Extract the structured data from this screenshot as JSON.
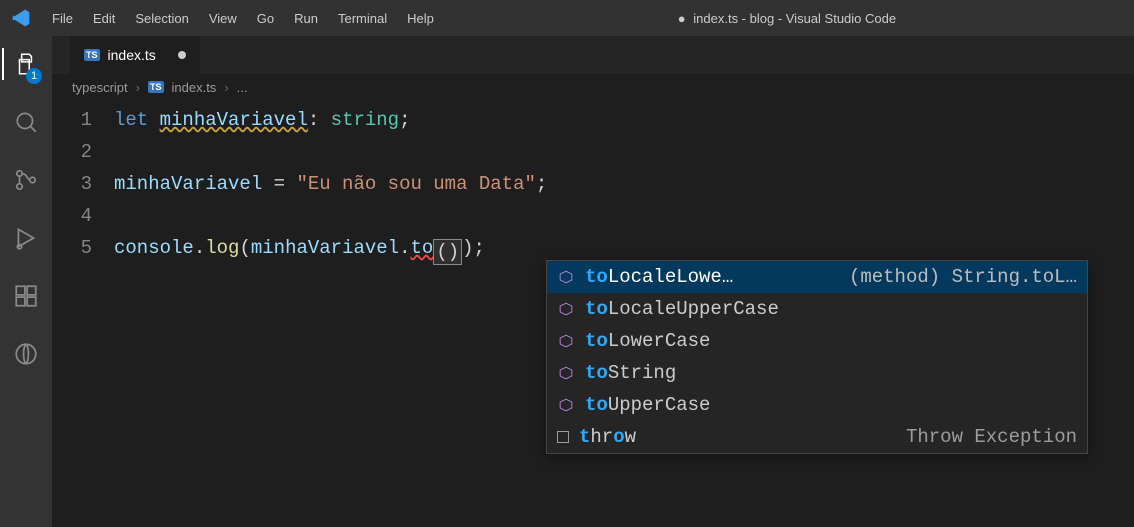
{
  "window": {
    "title_prefix": "●",
    "title": "index.ts - blog - Visual Studio Code"
  },
  "menu": {
    "items": [
      "File",
      "Edit",
      "Selection",
      "View",
      "Go",
      "Run",
      "Terminal",
      "Help"
    ]
  },
  "activity": {
    "explorer_badge": "1"
  },
  "tab": {
    "icon_text": "TS",
    "label": "index.ts"
  },
  "breadcrumbs": {
    "items": [
      "typescript",
      "index.ts",
      "..."
    ],
    "icon_text": "TS"
  },
  "editor": {
    "gutter": [
      "1",
      "2",
      "3",
      "4",
      "5"
    ],
    "line1": {
      "kw": "let",
      "sp1": " ",
      "var": "minhaVariavel",
      "colon": ":",
      "sp2": " ",
      "type": "string",
      "semi": ";"
    },
    "line3": {
      "var": "minhaVariavel",
      "sp1": " ",
      "eq": "=",
      "sp2": " ",
      "str": "\"Eu não sou uma Data\"",
      "semi": ";"
    },
    "line5": {
      "obj": "console",
      "dot1": ".",
      "method": "log",
      "lpar": "(",
      "arg": "minhaVariavel",
      "dot2": ".",
      "partial": "to",
      "inner": "()",
      "rpar": ")",
      "semi": ";"
    }
  },
  "suggest": {
    "items": [
      {
        "match": "to",
        "rest": "LocaleLowe…",
        "detail": "(method) String.toL…",
        "kind": "method"
      },
      {
        "match": "to",
        "rest": "LocaleUpperCase",
        "detail": "",
        "kind": "method"
      },
      {
        "match": "to",
        "rest": "LowerCase",
        "detail": "",
        "kind": "method"
      },
      {
        "match": "to",
        "rest": "String",
        "detail": "",
        "kind": "method"
      },
      {
        "match": "to",
        "rest": "UpperCase",
        "detail": "",
        "kind": "method"
      },
      {
        "match": "t",
        "mid": "hr",
        "match2": "o",
        "rest2": "w",
        "detail": "Throw Exception",
        "kind": "keyword"
      }
    ]
  }
}
